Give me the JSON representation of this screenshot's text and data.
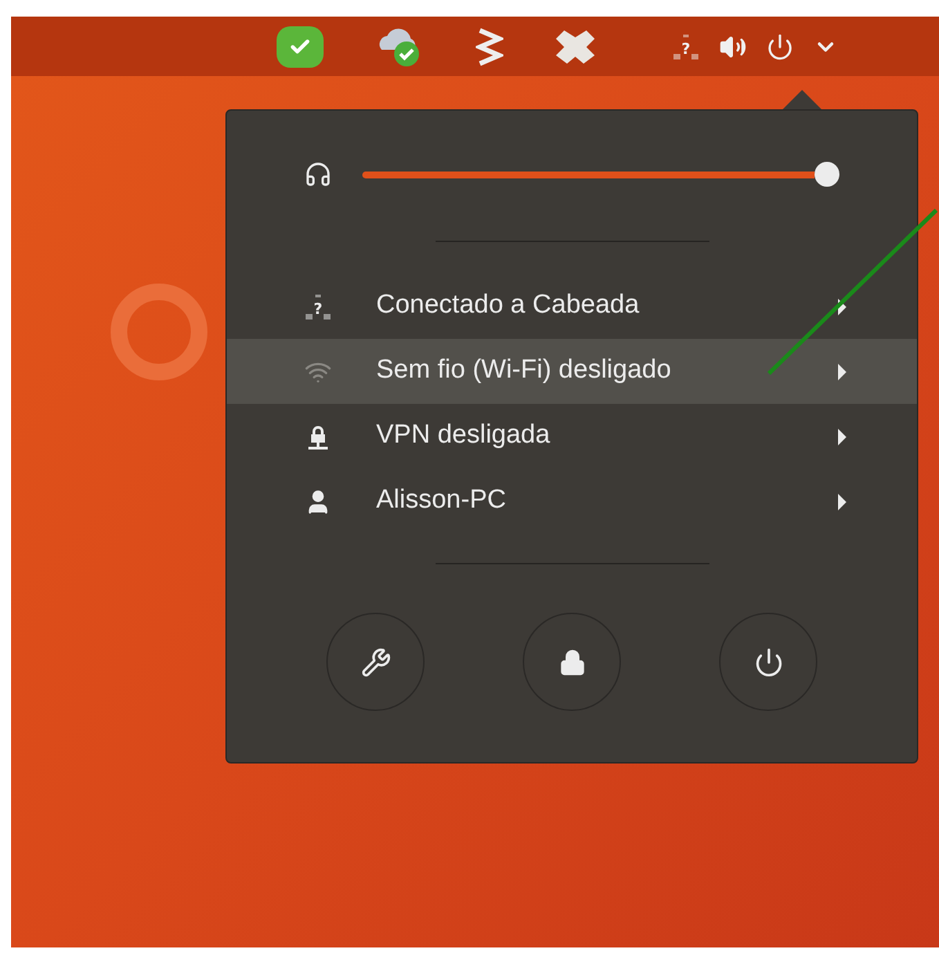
{
  "top_bar": {
    "network_glyph": "?",
    "tray": [
      {
        "kind": "chat"
      },
      {
        "kind": "cloud"
      },
      {
        "kind": "zigzag"
      },
      {
        "kind": "box"
      }
    ]
  },
  "menu": {
    "volume": {
      "level": 1.0
    },
    "items": [
      {
        "kind": "wired",
        "glyph": "?",
        "label": "Conectado a Cabeada",
        "selected": false,
        "disabled": false
      },
      {
        "kind": "wifi",
        "label": "Sem fio (Wi-Fi) desligado",
        "selected": true,
        "disabled": true
      },
      {
        "kind": "vpn",
        "label": "VPN desligada",
        "selected": false,
        "disabled": false
      },
      {
        "kind": "user",
        "label": "Alisson-PC",
        "selected": false,
        "disabled": false
      }
    ],
    "actions": [
      {
        "kind": "settings"
      },
      {
        "kind": "lock"
      },
      {
        "kind": "power"
      }
    ]
  }
}
